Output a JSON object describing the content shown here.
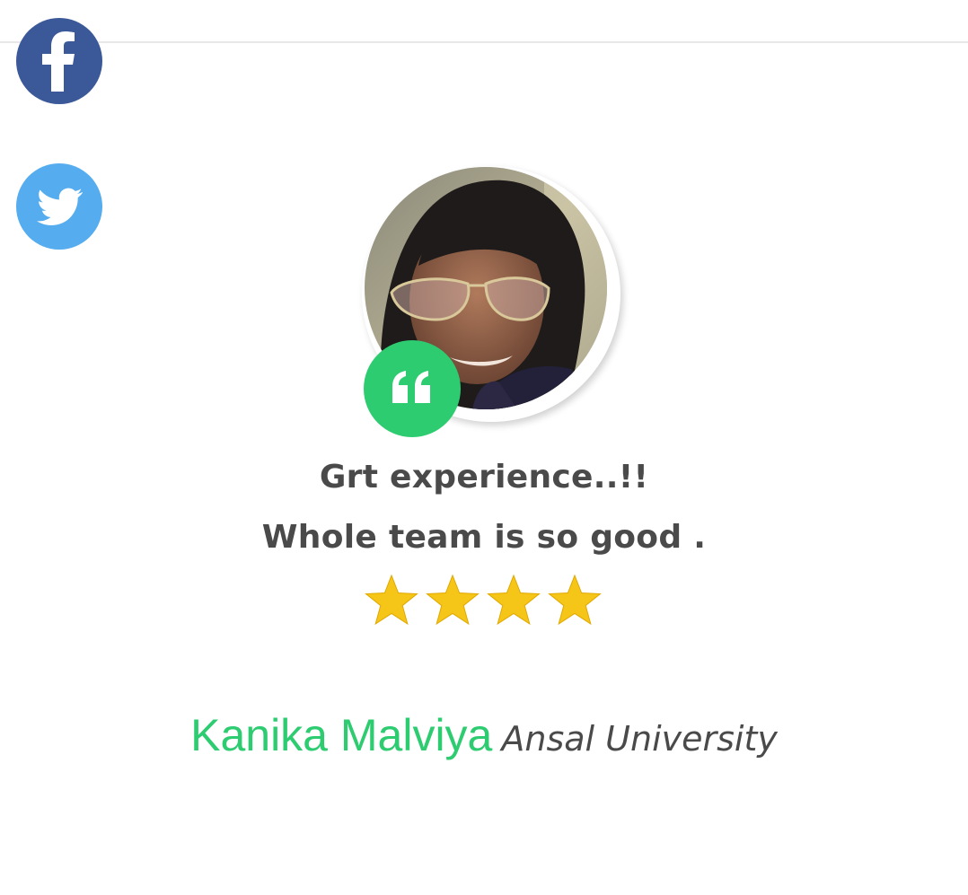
{
  "social": {
    "facebook_icon": "facebook-icon",
    "twitter_icon": "twitter-icon",
    "facebook_color": "#3b5998",
    "twitter_color": "#55acee"
  },
  "testimonial": {
    "avatar_icon": "profile-photo",
    "quote_icon": "quote-icon",
    "accent_color": "#2ecc71",
    "text_line_1": "Grt experience..!!",
    "text_line_2": "Whole team is so good .",
    "rating": 4,
    "star_color": "#f5c518",
    "author_name": "Kanika Malviya",
    "author_org": "Ansal University"
  }
}
